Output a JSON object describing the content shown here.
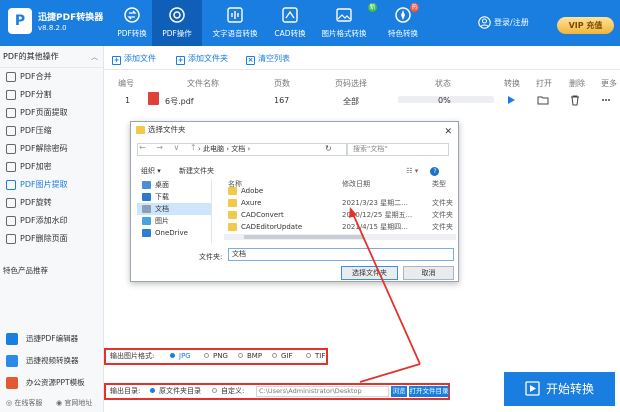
{
  "app": {
    "name": "迅捷PDF转换器",
    "version": "v8.8.2.0",
    "logo_letter": "P"
  },
  "nav": {
    "tabs": [
      {
        "label": "PDF转换",
        "icon": "refresh-arrows-icon"
      },
      {
        "label": "PDF操作",
        "icon": "gear-icon"
      },
      {
        "label": "文字语音转换",
        "icon": "soundwave-icon"
      },
      {
        "label": "CAD转换",
        "icon": "cad-icon"
      },
      {
        "label": "图片格式转换",
        "icon": "image-icon"
      },
      {
        "label": "特色转换",
        "icon": "rocket-icon"
      }
    ],
    "badges": [
      "新",
      "热"
    ],
    "login_label": "登录/注册",
    "vip_label": "VIP 充值"
  },
  "sidebar": {
    "header": "PDF的其他操作",
    "items": [
      "PDF合并",
      "PDF分割",
      "PDF页面提取",
      "PDF压缩",
      "PDF解除密码",
      "PDF加密",
      "PDF图片提取",
      "PDF旋转",
      "PDF添加水印",
      "PDF删除页面"
    ],
    "active_index": 6,
    "section_title": "特色产品推荐",
    "products": [
      "迅捷PDF编辑器",
      "迅捷视频转换器",
      "办公资源PPT模板"
    ],
    "footer": {
      "service": "在线客服",
      "website": "官网地址"
    }
  },
  "toolbar": {
    "add_file": "添加文件",
    "add_folder": "添加文件夹",
    "clear_list": "清空列表"
  },
  "table": {
    "headers": [
      "编号",
      "文件名称",
      "页数",
      "页码选择",
      "状态",
      "转换",
      "打开",
      "删除",
      "更多"
    ],
    "rows": [
      {
        "index": "1",
        "name": "6号.pdf",
        "pages": "167",
        "range": "全部",
        "progress": "0%"
      }
    ]
  },
  "dialog": {
    "title": "选择文件夹",
    "nav_arrows": "← → ∨ ↑",
    "breadcrumb": "›  此电脑  ›  文档  ›",
    "search_placeholder": "搜索\"文档\"",
    "organize": "组织 ▾",
    "new_folder": "新建文件夹",
    "tree": [
      {
        "label": "桌面",
        "color": "#4a90d9"
      },
      {
        "label": "下载",
        "color": "#2a7ad1"
      },
      {
        "label": "文档",
        "color": "#8aa0b8"
      },
      {
        "label": "图片",
        "color": "#4aa3df"
      },
      {
        "label": "OneDrive",
        "color": "#2d7dd2"
      }
    ],
    "columns": {
      "name": "名称",
      "date": "修改日期",
      "type": "类型"
    },
    "files": [
      {
        "name": "Adobe",
        "date": "",
        "type": ""
      },
      {
        "name": "Axure",
        "date": "2021/3/23 星期二...",
        "type": "文件夹"
      },
      {
        "name": "CADConvert",
        "date": "2020/12/25 星期五...",
        "type": "文件夹"
      },
      {
        "name": "CADEditorUpdate",
        "date": "2021/4/15 星期四...",
        "type": "文件夹"
      }
    ],
    "folder_label": "文件夹:",
    "folder_value": "文档",
    "select_button": "选择文件夹",
    "cancel_button": "取消"
  },
  "image_format": {
    "label": "输出图片格式:",
    "options": [
      "JPG",
      "PNG",
      "BMP",
      "GIF",
      "TIF"
    ],
    "selected": "JPG"
  },
  "output": {
    "label": "输出目录:",
    "option_source": "原文件夹目录",
    "option_custom": "自定义:",
    "path": "C:\\Users\\Administrator\\Desktop",
    "browse": "浏览",
    "open_folder": "打开文件目录"
  },
  "start_button": "开始转换",
  "colors": {
    "brand": "#1a7de0",
    "highlight": "#e4322b",
    "active_tab": "#0f5fb8",
    "vip": "#f2b43a"
  }
}
